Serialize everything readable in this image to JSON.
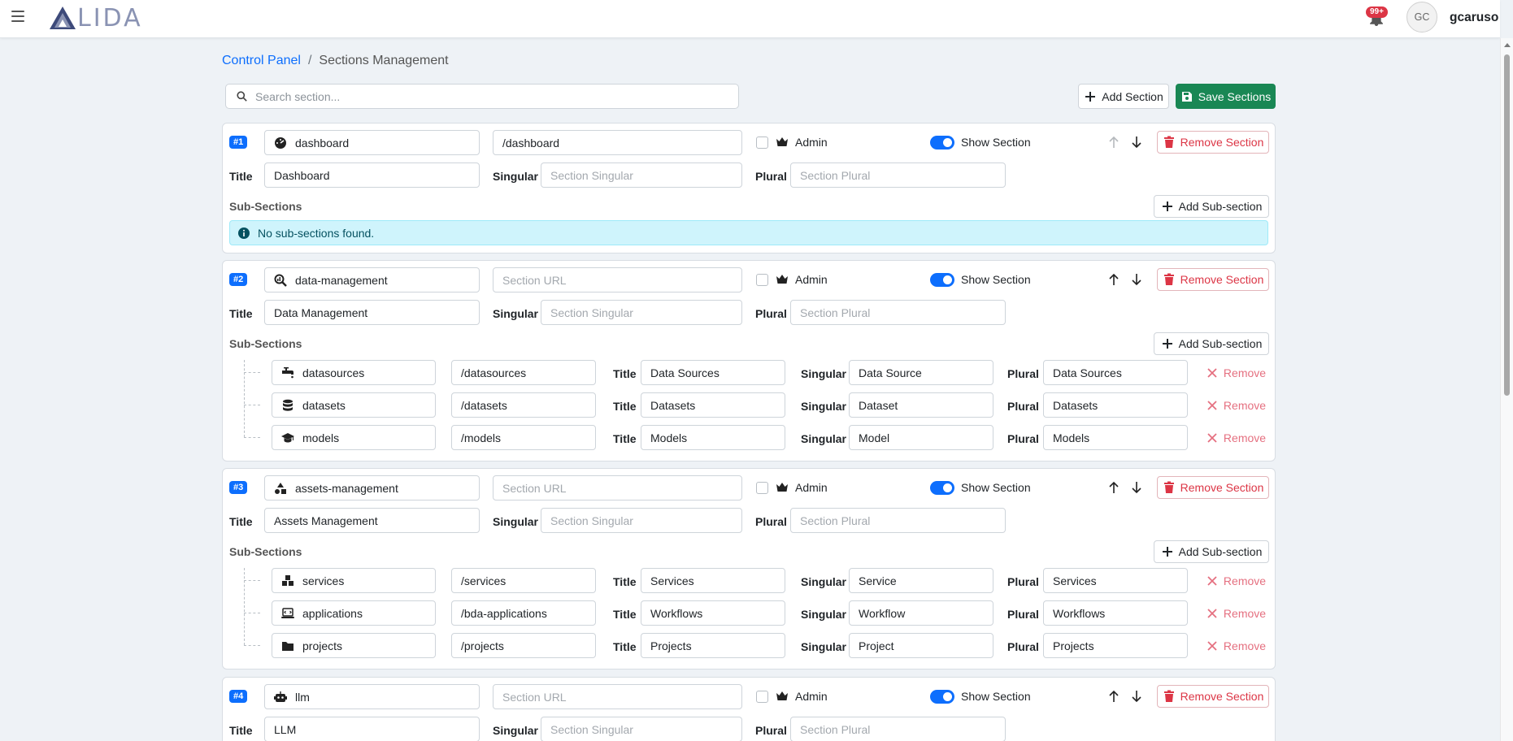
{
  "header": {
    "logo_text": "LIDA",
    "notification_count": "99+",
    "avatar_initials": "GC",
    "username": "gcaruso"
  },
  "breadcrumb": {
    "root": "Control Panel",
    "separator": "/",
    "current": "Sections Management"
  },
  "search": {
    "placeholder": "Search section..."
  },
  "toolbar": {
    "add_section": "Add Section",
    "save_sections": "Save Sections"
  },
  "labels": {
    "title": "Title",
    "singular": "Singular",
    "plural": "Plural",
    "admin": "Admin",
    "show_section": "Show Section",
    "remove_section": "Remove Section",
    "sub_sections": "Sub-Sections",
    "add_sub_section": "Add Sub-section",
    "remove": "Remove",
    "url_placeholder": "Section URL",
    "singular_placeholder": "Section Singular",
    "plural_placeholder": "Section Plural",
    "no_subsections": "No sub-sections found."
  },
  "sections": [
    {
      "number": "#1",
      "key": "dashboard",
      "icon": "gauge-icon",
      "url": "/dashboard",
      "title": "Dashboard",
      "singular": "",
      "plural": "",
      "admin": false,
      "show": true,
      "subsections": []
    },
    {
      "number": "#2",
      "key": "data-management",
      "icon": "magnify-data-icon",
      "url": "",
      "title": "Data Management",
      "singular": "",
      "plural": "",
      "admin": false,
      "show": true,
      "subsections": [
        {
          "key": "datasources",
          "icon": "faucet-icon",
          "url": "/datasources",
          "title": "Data Sources",
          "singular": "Data Source",
          "plural": "Data Sources"
        },
        {
          "key": "datasets",
          "icon": "database-icon",
          "url": "/datasets",
          "title": "Datasets",
          "singular": "Dataset",
          "plural": "Datasets"
        },
        {
          "key": "models",
          "icon": "graduation-cap-icon",
          "url": "/models",
          "title": "Models",
          "singular": "Model",
          "plural": "Models"
        }
      ]
    },
    {
      "number": "#3",
      "key": "assets-management",
      "icon": "shapes-icon",
      "url": "",
      "title": "Assets Management",
      "singular": "",
      "plural": "",
      "admin": false,
      "show": true,
      "subsections": [
        {
          "key": "services",
          "icon": "cubes-icon",
          "url": "/services",
          "title": "Services",
          "singular": "Service",
          "plural": "Services"
        },
        {
          "key": "applications",
          "icon": "laptop-code-icon",
          "url": "/bda-applications",
          "title": "Workflows",
          "singular": "Workflow",
          "plural": "Workflows"
        },
        {
          "key": "projects",
          "icon": "folder-icon",
          "url": "/projects",
          "title": "Projects",
          "singular": "Project",
          "plural": "Projects"
        }
      ]
    },
    {
      "number": "#4",
      "key": "llm",
      "icon": "robot-icon",
      "url": "",
      "title": "LLM",
      "singular": "",
      "plural": "",
      "admin": false,
      "show": true,
      "subsections": []
    }
  ],
  "colors": {
    "primary": "#0d6efd",
    "success": "#198754",
    "danger": "#dc3545",
    "info_bg": "#cff4fc"
  }
}
